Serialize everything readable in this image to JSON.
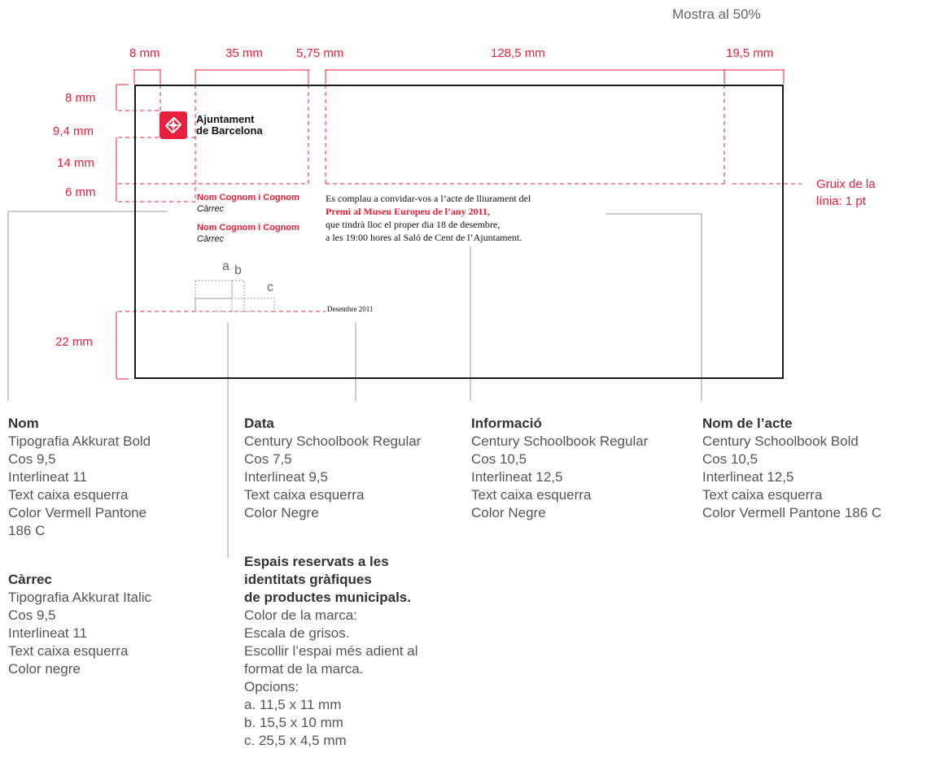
{
  "header": {
    "sample_note": "Mostra al 50%"
  },
  "dimensions_top": [
    "8 mm",
    "35 mm",
    "5,75 mm",
    "128,5 mm",
    "19,5 mm"
  ],
  "dimensions_left": [
    "8 mm",
    "9,4 mm",
    "14 mm",
    "6 mm",
    "22 mm"
  ],
  "line_note": [
    "Gruix de la",
    "línia: 1 pt"
  ],
  "card": {
    "brand": [
      "Ajuntament",
      "de Barcelona"
    ],
    "names": [
      {
        "name": "Nom Cognom i Cognom",
        "role": "Càrrec"
      },
      {
        "name": "Nom Cognom i Cognom",
        "role": "Càrrec"
      }
    ],
    "body_line1": "Es complau a convidar-vos a l’acte de lliurament del",
    "event_name": "Premi al Museu Europeu de l’any 2011,",
    "body_line3": "que tindrà lloc el proper dia 18 de desembre,",
    "body_line4": "a les 19:00 hores al Saló de Cent de l’Ajuntament.",
    "date": "Desembre 2011",
    "slot_labels": [
      "a",
      "b",
      "c"
    ]
  },
  "annotations": {
    "nom": {
      "title": "Nom",
      "lines": [
        "Tipografia Akkurat Bold",
        "Cos 9,5",
        "Interlineat 11",
        "Text caixa esquerra",
        "Color Vermell Pantone",
        "186 C"
      ]
    },
    "carrec": {
      "title": "Càrrec",
      "lines": [
        "Tipografia Akkurat Italic",
        "Cos 9,5",
        "Interlineat 11",
        "Text caixa esquerra",
        "Color negre"
      ]
    },
    "data": {
      "title": "Data",
      "lines": [
        "Century Schoolbook Regular",
        "Cos 7,5",
        "Interlineat 9,5",
        "Text caixa esquerra",
        "Color Negre"
      ]
    },
    "espais": {
      "title_lines": [
        "Espais reservats a les",
        "identitats gràfiques",
        "de productes municipals."
      ],
      "lines": [
        "Color de la marca:",
        "Escala de grisos.",
        "Escollir l’espai més adient al",
        "format de la marca.",
        "Opcions:",
        "a. 11,5 x 11 mm",
        "b. 15,5 x 10 mm",
        "c. 25,5 x 4,5 mm"
      ]
    },
    "informacio": {
      "title": "Informació",
      "lines": [
        "Century Schoolbook Regular",
        "Cos 10,5",
        "Interlineat 12,5",
        "Text caixa esquerra",
        "Color Negre"
      ]
    },
    "nom_acte": {
      "title": "Nom de l’acte",
      "lines": [
        "Century Schoolbook Bold",
        "Cos 10,5",
        "Interlineat 12,5",
        "Text caixa esquerra",
        "Color Vermell Pantone 186 C"
      ]
    }
  },
  "colors": {
    "accent_red": "#e8203b",
    "frame": "#1a1a1a",
    "text_gray": "#555555"
  }
}
